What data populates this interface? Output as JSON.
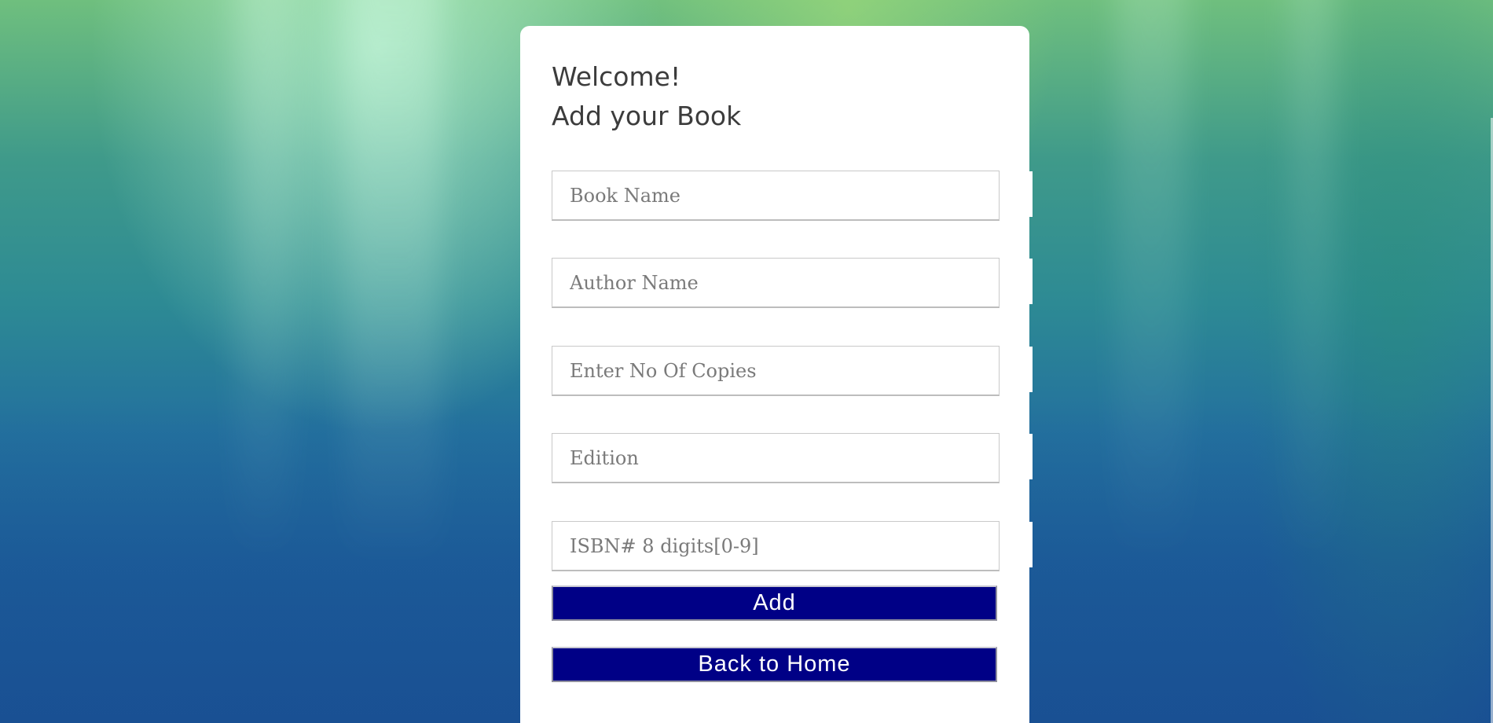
{
  "form": {
    "heading_line1": "Welcome!",
    "heading_line2": "Add your Book",
    "fields": {
      "book_name": {
        "placeholder": "Book Name",
        "value": ""
      },
      "author_name": {
        "placeholder": "Author Name",
        "value": ""
      },
      "copies": {
        "placeholder": "Enter No Of Copies",
        "value": ""
      },
      "edition": {
        "placeholder": "Edition",
        "value": ""
      },
      "isbn": {
        "placeholder": "ISBN# 8 digits[0-9]",
        "value": ""
      }
    },
    "buttons": {
      "add": "Add",
      "back_home": "Back to Home"
    }
  },
  "colors": {
    "button_bg": "#000086",
    "card_bg": "#ffffff",
    "background_top": "#6fbf7e",
    "background_bottom": "#1c5597"
  }
}
